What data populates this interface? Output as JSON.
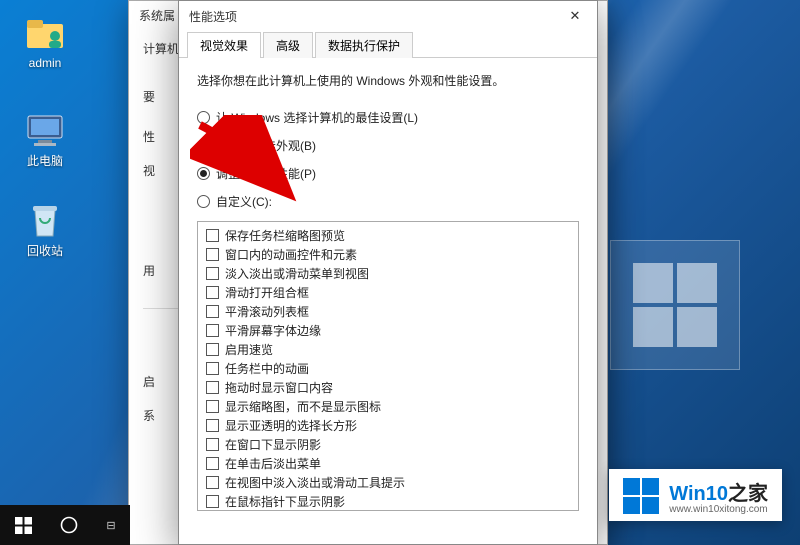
{
  "desktop": {
    "admin": "admin",
    "thispc": "此电脑",
    "recycle": "回收站"
  },
  "backDialog": {
    "title": "系统属",
    "body_lines": [
      "计算机",
      "要",
      "性",
      "视",
      "用",
      "启",
      "系"
    ]
  },
  "dialog": {
    "title": "性能选项",
    "tabs": [
      "视觉效果",
      "高级",
      "数据执行保护"
    ],
    "description": "选择你想在此计算机上使用的 Windows 外观和性能设置。",
    "radios": [
      {
        "label": "让 Windows 选择计算机的最佳设置(L)",
        "checked": false
      },
      {
        "label": "调整为最佳外观(B)",
        "checked": false
      },
      {
        "label": "调整为最佳性能(P)",
        "checked": true
      },
      {
        "label": "自定义(C):",
        "checked": false
      }
    ],
    "checks": [
      "保存任务栏缩略图预览",
      "窗口内的动画控件和元素",
      "淡入淡出或滑动菜单到视图",
      "滑动打开组合框",
      "平滑滚动列表框",
      "平滑屏幕字体边缘",
      "启用速览",
      "任务栏中的动画",
      "拖动时显示窗口内容",
      "显示缩略图，而不是显示图标",
      "显示亚透明的选择长方形",
      "在窗口下显示阴影",
      "在单击后淡出菜单",
      "在视图中淡入淡出或滑动工具提示",
      "在鼠标指针下显示阴影"
    ]
  },
  "watermark": {
    "brand_a": "Win10",
    "brand_b": "之家",
    "url": "www.win10xitong.com"
  }
}
